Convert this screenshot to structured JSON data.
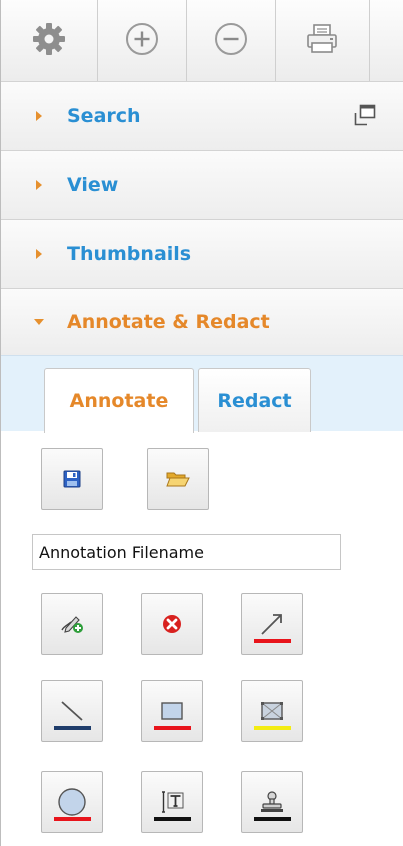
{
  "toolbar": {
    "buttons": [
      {
        "name": "settings",
        "icon": "gear-icon"
      },
      {
        "name": "zoom-in",
        "icon": "plus-circle-icon"
      },
      {
        "name": "zoom-out",
        "icon": "minus-circle-icon"
      },
      {
        "name": "print",
        "icon": "printer-icon"
      }
    ]
  },
  "accordion": {
    "search": {
      "label": "Search",
      "icon": "popout-icon"
    },
    "view": {
      "label": "View"
    },
    "thumbnails": {
      "label": "Thumbnails"
    },
    "annotate": {
      "label": "Annotate & Redact"
    }
  },
  "tabs": {
    "annotate": "Annotate",
    "redact": "Redact"
  },
  "file": {
    "filename_value": "Annotation Filename",
    "save_icon": "floppy-icon",
    "open_icon": "folder-open-icon"
  },
  "tools": [
    {
      "name": "freehand",
      "icon": "pencil-plus-icon",
      "underline": ""
    },
    {
      "name": "delete",
      "icon": "red-x-circle-icon",
      "underline": ""
    },
    {
      "name": "arrow",
      "icon": "arrow-icon",
      "underline": "#e8141b"
    },
    {
      "name": "line",
      "icon": "line-icon",
      "underline": "#1f3d6b"
    },
    {
      "name": "rectangle",
      "icon": "rectangle-icon",
      "underline": "#e8141b"
    },
    {
      "name": "highlight",
      "icon": "highlight-rect-icon",
      "underline": "#f3ec12"
    },
    {
      "name": "ellipse",
      "icon": "ellipse-icon",
      "underline": "#e8141b"
    },
    {
      "name": "text",
      "icon": "text-tool-icon",
      "underline": "#111111"
    },
    {
      "name": "stamp",
      "icon": "stamp-icon",
      "underline": "#111111"
    }
  ],
  "colors": {
    "accent_orange": "#e5882a",
    "link_blue": "#2a8fd3",
    "tab_strip": "#e3f1fb"
  }
}
